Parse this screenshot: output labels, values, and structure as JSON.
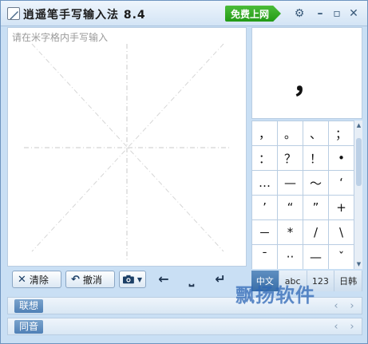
{
  "app": {
    "title": "逍遥笔手写输入法 8.4",
    "online_label": "免费上网"
  },
  "titlebar_icons": [
    "gear-icon",
    "minimize-icon",
    "maximize-icon",
    "close-icon"
  ],
  "pad": {
    "placeholder": "请在米字格内手写输入"
  },
  "toolbar": {
    "clear_label": "清除",
    "undo_label": "撤消"
  },
  "preview": {
    "char": "，"
  },
  "symbols": [
    "，",
    "。",
    "、",
    "；",
    "：",
    "？",
    "！",
    "•",
    "…",
    "—",
    "～",
    "‘",
    "’",
    "“",
    "”",
    "+",
    "－",
    "*",
    "/",
    "\\",
    "¯",
    "··",
    "—",
    "ˇ"
  ],
  "modes": [
    "中文",
    "abc",
    "123",
    "日韩"
  ],
  "suggest": {
    "lianxiang": "联想",
    "tongyin": "同音"
  },
  "watermark": "飘扬软件",
  "colors": {
    "accent_green": "#229a15",
    "active_mode": "#3a6fa8",
    "frame": "#c9dff4"
  }
}
